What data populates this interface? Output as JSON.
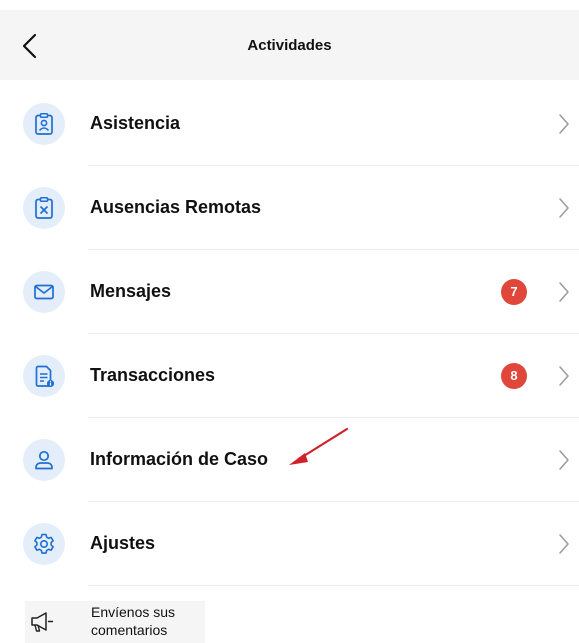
{
  "header": {
    "title": "Actividades",
    "back_icon": "chevron-left-icon"
  },
  "menu": {
    "items": [
      {
        "label": "Asistencia",
        "icon": "clipboard-user-icon",
        "badge": null
      },
      {
        "label": "Ausencias Remotas",
        "icon": "clipboard-x-icon",
        "badge": null
      },
      {
        "label": "Mensajes",
        "icon": "envelope-icon",
        "badge": "7"
      },
      {
        "label": "Transacciones",
        "icon": "document-info-icon",
        "badge": "8"
      },
      {
        "label": "Información de Caso",
        "icon": "user-icon",
        "badge": null
      },
      {
        "label": "Ajustes",
        "icon": "gear-icon",
        "badge": null
      }
    ]
  },
  "feedback": {
    "line1": "Envíenos sus",
    "line2": "comentarios",
    "icon": "megaphone-icon"
  },
  "colors": {
    "icon_blue": "#1f6fd1",
    "icon_bg": "#e3eefa",
    "badge_red": "#e0463a",
    "header_bg": "#f5f5f5",
    "annotation_arrow": "#d0202a"
  }
}
